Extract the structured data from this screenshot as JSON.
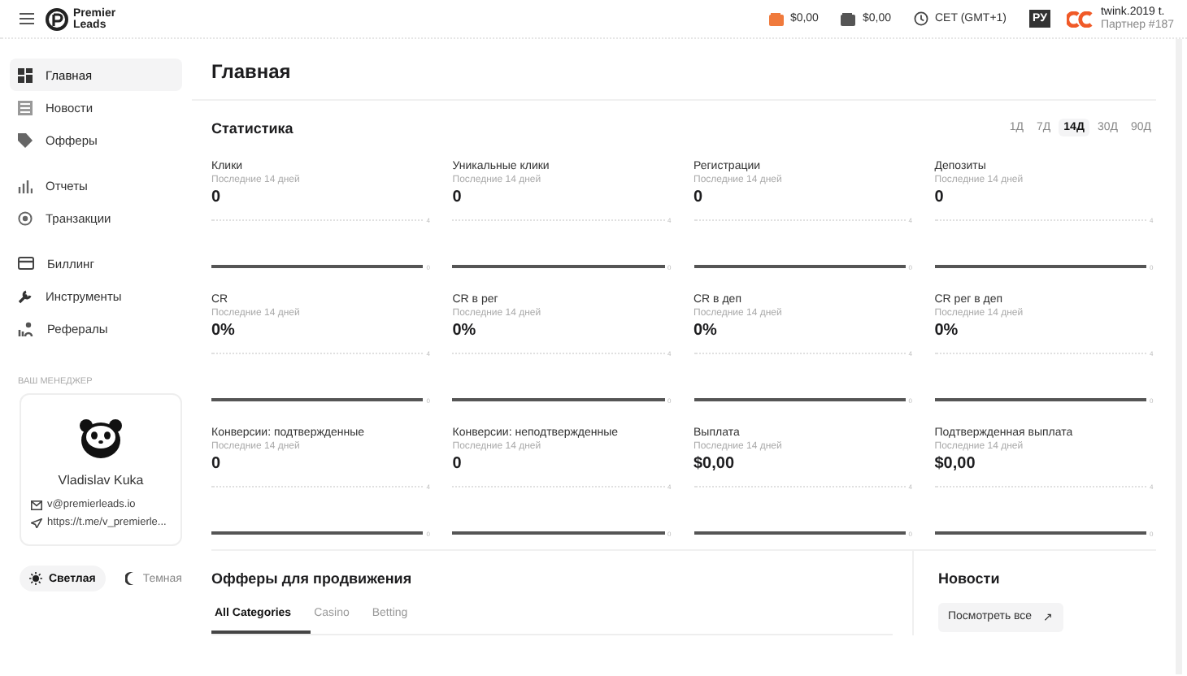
{
  "header": {
    "brand": [
      "Premier",
      "Leads"
    ],
    "balances": [
      {
        "kind": "main",
        "amount": "$0,00"
      },
      {
        "kind": "hold",
        "amount": "$0,00"
      }
    ],
    "timezone": "CET (GMT+1)",
    "language": "РУ",
    "user": {
      "name": "twink.2019 t.",
      "partner": "Партнер #187"
    }
  },
  "sidebar": {
    "groups": [
      [
        {
          "label": "Главная",
          "selected": true
        },
        {
          "label": "Новости",
          "selected": false
        },
        {
          "label": "Офферы",
          "selected": false
        }
      ],
      [
        {
          "label": "Отчеты",
          "selected": false
        },
        {
          "label": "Транзакции",
          "selected": false
        }
      ],
      [
        {
          "label": "Биллинг",
          "selected": false
        },
        {
          "label": "Инструменты",
          "selected": false
        },
        {
          "label": "Рефералы",
          "selected": false
        }
      ]
    ],
    "manager": {
      "section_label": "ВАШ МЕНЕДЖЕР",
      "name": "Vladislav Kuka",
      "email": "v@premierleads.io",
      "telegram": "https://t.me/v_premierle..."
    },
    "theme": [
      {
        "label": "Светлая",
        "selected": true
      },
      {
        "label": "Темная",
        "selected": false
      }
    ]
  },
  "page_title": "Главная",
  "statistics": {
    "title": "Статистика",
    "periods": [
      {
        "label": "1Д",
        "selected": false
      },
      {
        "label": "7Д",
        "selected": false
      },
      {
        "label": "14Д",
        "selected": true
      },
      {
        "label": "30Д",
        "selected": false
      },
      {
        "label": "90Д",
        "selected": false
      }
    ],
    "cards": [
      {
        "title": "Клики",
        "period": "Последние 14 дней",
        "value": "0",
        "scale_labels": [
          "4",
          "0"
        ]
      },
      {
        "title": "Уникальные клики",
        "period": "Последние 14 дней",
        "value": "0",
        "scale_labels": [
          "4",
          "0"
        ]
      },
      {
        "title": "Регистрации",
        "period": "Последние 14 дней",
        "value": "0",
        "scale_labels": [
          "4",
          "0"
        ]
      },
      {
        "title": "Депозиты",
        "period": "Последние 14 дней",
        "value": "0",
        "scale_labels": [
          "4",
          "0"
        ]
      },
      {
        "title": "CR",
        "period": "Последние 14 дней",
        "value": "0%",
        "scale_labels": [
          "4",
          "0"
        ]
      },
      {
        "title": "CR в рег",
        "period": "Последние 14 дней",
        "value": "0%",
        "scale_labels": [
          "4",
          "0"
        ]
      },
      {
        "title": "CR в деп",
        "period": "Последние 14 дней",
        "value": "0%",
        "scale_labels": [
          "4",
          "0"
        ]
      },
      {
        "title": "CR рег в деп",
        "period": "Последние 14 дней",
        "value": "0%",
        "scale_labels": [
          "4",
          "0"
        ]
      },
      {
        "title": "Конверсии: подтвержденные",
        "period": "Последние 14 дней",
        "value": "0",
        "scale_labels": [
          "4",
          "0"
        ]
      },
      {
        "title": "Конверсии: неподтвержденные",
        "period": "Последние 14 дней",
        "value": "0",
        "scale_labels": [
          "4",
          "0"
        ]
      },
      {
        "title": "Выплата",
        "period": "Последние 14 дней",
        "value": "$0,00",
        "scale_labels": [
          "4",
          "0"
        ]
      },
      {
        "title": "Подтвержденная выплата",
        "period": "Последние 14 дней",
        "value": "$0,00",
        "scale_labels": [
          "4",
          "0"
        ]
      }
    ]
  },
  "offers": {
    "title": "Офферы для продвижения",
    "tabs": [
      {
        "label": "All Categories",
        "selected": true
      },
      {
        "label": "Casino",
        "selected": false
      },
      {
        "label": "Betting",
        "selected": false
      }
    ]
  },
  "news": {
    "title": "Новости",
    "button": "Посмотреть все",
    "button_icon": "↗"
  }
}
